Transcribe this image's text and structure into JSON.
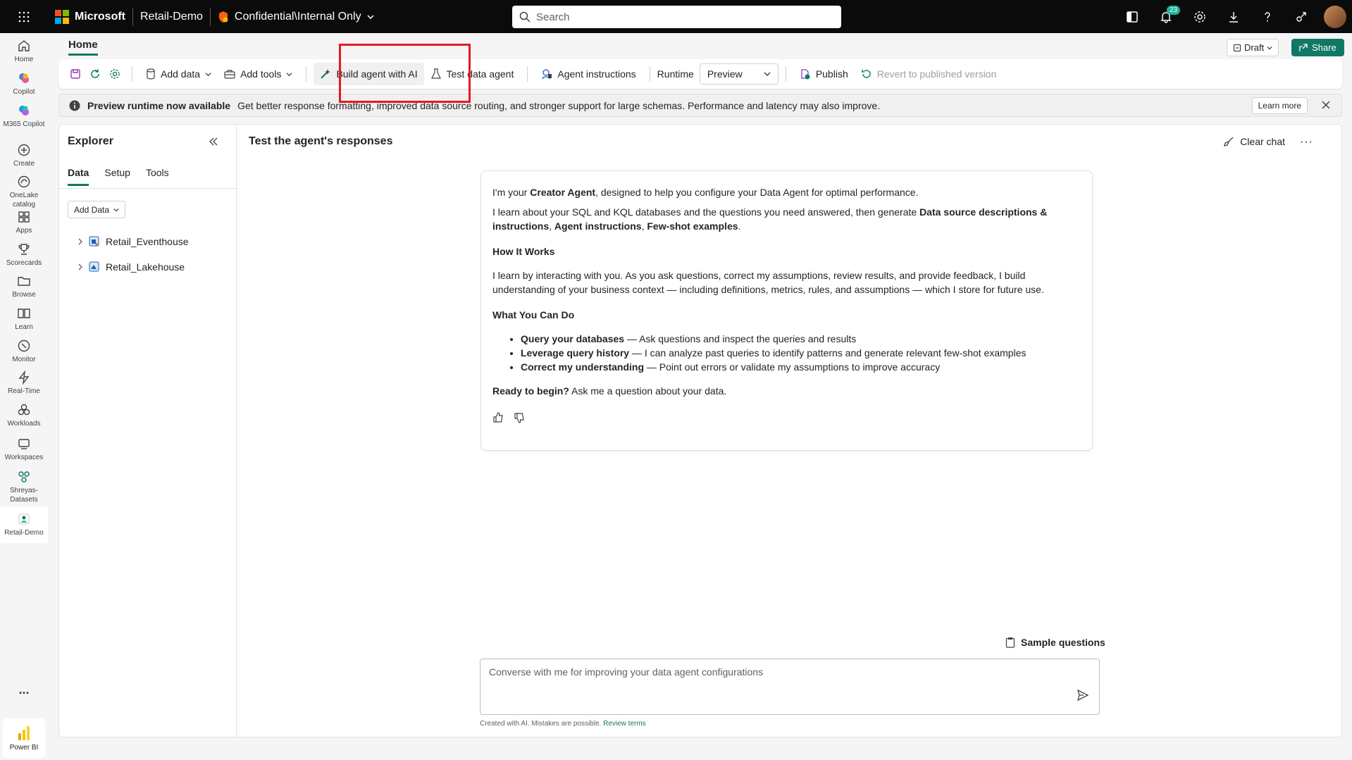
{
  "topbar": {
    "brand": "Microsoft",
    "workspace": "Retail-Demo",
    "sensitivity": "Confidential\\Internal Only",
    "search_placeholder": "Search",
    "notifications_count": "23"
  },
  "leftnav": [
    {
      "label": "Home",
      "icon": "home-icon"
    },
    {
      "label": "Copilot",
      "icon": "copilot-icon"
    },
    {
      "label": "M365 Copilot",
      "icon": "m365-copilot-icon"
    },
    {
      "label": "Create",
      "icon": "plus-circle-icon"
    },
    {
      "label": "OneLake catalog",
      "icon": "onelake-icon"
    },
    {
      "label": "Apps",
      "icon": "apps-icon"
    },
    {
      "label": "Scorecards",
      "icon": "trophy-icon"
    },
    {
      "label": "Browse",
      "icon": "folder-icon"
    },
    {
      "label": "Learn",
      "icon": "book-icon"
    },
    {
      "label": "Monitor",
      "icon": "monitor-icon"
    },
    {
      "label": "Real-Time",
      "icon": "lightning-icon"
    },
    {
      "label": "Workloads",
      "icon": "workloads-icon"
    },
    {
      "label": "Workspaces",
      "icon": "workspaces-icon"
    },
    {
      "label": "Shreyas-Datasets",
      "icon": "dataset-icon"
    },
    {
      "label": "Retail-Demo",
      "icon": "agent-icon"
    }
  ],
  "more_label": "...",
  "powerbi_label": "Power BI",
  "header": {
    "home_tab": "Home",
    "draft_label": "Draft",
    "share_label": "Share"
  },
  "toolbar": {
    "add_data": "Add data",
    "add_tools": "Add tools",
    "build_agent": "Build agent with AI",
    "test_agent": "Test data agent",
    "agent_instructions": "Agent instructions",
    "runtime_label": "Runtime",
    "runtime_value": "Preview",
    "publish": "Publish",
    "revert": "Revert to published version"
  },
  "banner": {
    "title": "Preview runtime now available",
    "text": "Get better response formatting, improved data source routing, and stronger support for large schemas. Performance and latency may also improve.",
    "learn_more": "Learn more"
  },
  "explorer": {
    "title": "Explorer",
    "tabs": [
      "Data",
      "Setup",
      "Tools"
    ],
    "add_data": "Add Data",
    "items": [
      "Retail_Eventhouse",
      "Retail_Lakehouse"
    ]
  },
  "chat": {
    "title": "Test the agent's responses",
    "clear_chat": "Clear chat",
    "intro_pre": "I'm your ",
    "intro_bold": "Creator Agent",
    "intro_post": ", designed to help you configure your Data Agent for optimal performance.",
    "learn_pre": "I learn about your SQL and KQL databases and the questions you need answered, then generate ",
    "learn_bold1": "Data source descriptions & instructions",
    "learn_bold2": "Agent instructions",
    "learn_bold3": "Few-shot examples",
    "how_title": "How It Works",
    "how_text": "I learn by interacting with you. As you ask questions, correct my assumptions, review results, and provide feedback, I build understanding of your business context — including definitions, metrics, rules, and assumptions — which I store for future use.",
    "what_title": "What You Can Do",
    "bullets": [
      {
        "bold": "Query your databases",
        "text": " — Ask questions and inspect the queries and results"
      },
      {
        "bold": "Leverage query history",
        "text": " — I can analyze past queries to identify patterns and generate relevant few-shot examples"
      },
      {
        "bold": "Correct my understanding",
        "text": " — Point out errors or validate my assumptions to improve accuracy"
      }
    ],
    "ready_bold": "Ready to begin?",
    "ready_text": " Ask me a question about your data.",
    "sample_questions": "Sample questions",
    "input_placeholder": "Converse with me for improving your data agent configurations",
    "disclaimer": "Created with AI. Mistakes are possible.",
    "review_terms": "Review terms"
  }
}
